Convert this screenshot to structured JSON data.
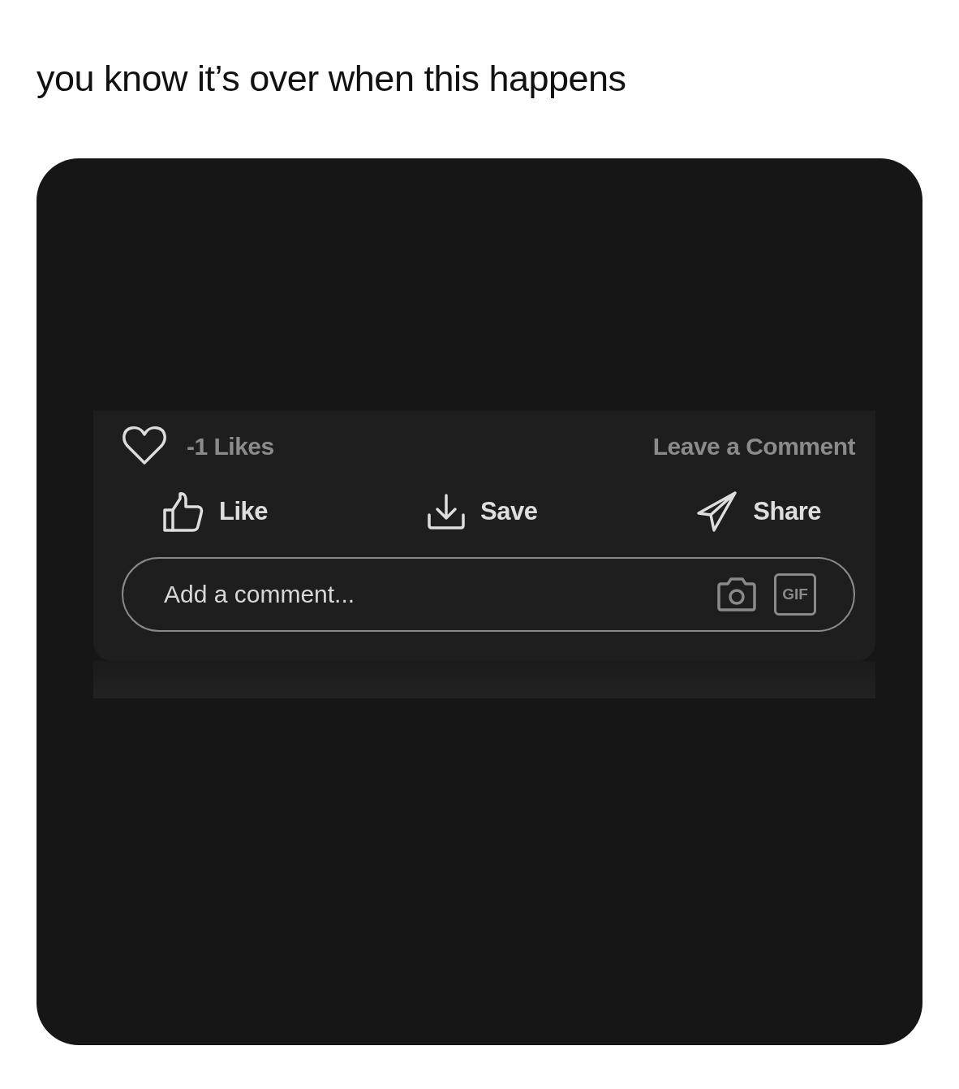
{
  "caption": "you know it’s over when this happens",
  "post_footer": {
    "likes_count": "-1 Likes",
    "comment_link": "Leave a Comment",
    "actions": [
      {
        "kind": "like",
        "label": "Like"
      },
      {
        "kind": "save",
        "label": "Save"
      },
      {
        "kind": "share",
        "label": "Share"
      }
    ],
    "comment_box": {
      "placeholder": "Add a comment...",
      "gif_label": "GIF"
    }
  }
}
